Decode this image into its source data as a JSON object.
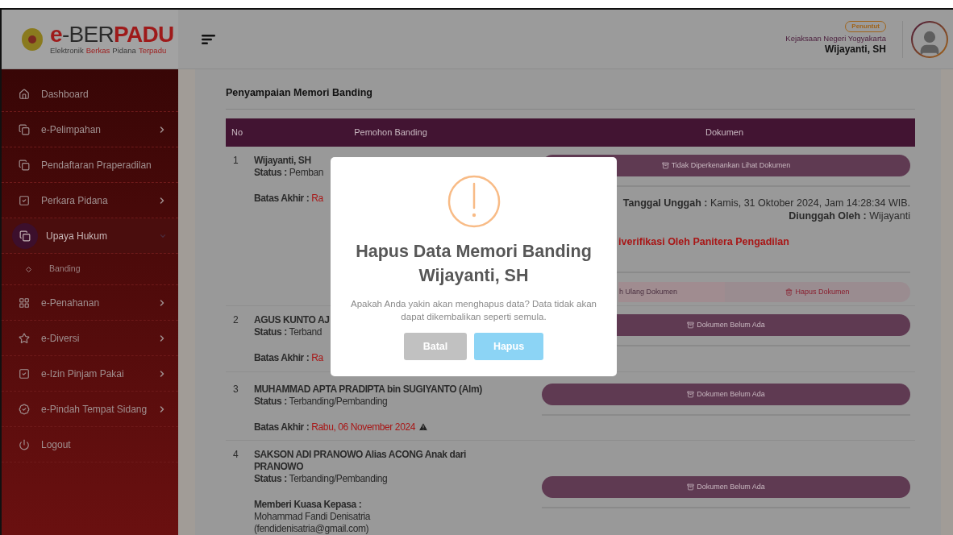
{
  "header": {
    "logo": {
      "title": [
        {
          "text": "e",
          "accent": true
        },
        {
          "text": "-BER",
          "accent": false
        },
        {
          "text": "PADU",
          "accent": true
        }
      ],
      "subtitle": [
        {
          "text": "Elektronik",
          "accent": false
        },
        {
          "text": "Berkas",
          "accent": true
        },
        {
          "text": "Pidana",
          "accent": false
        },
        {
          "text": "Terpadu",
          "accent": true
        }
      ]
    },
    "user": {
      "role": "Penuntut",
      "office": "Kejaksaan Negeri Yogyakarta",
      "name": "Wijayanti, SH"
    }
  },
  "sidebar": {
    "items": [
      {
        "label": "Dashboard",
        "submenu": false,
        "selected": false
      },
      {
        "label": "e-Pelimpahan",
        "submenu": true,
        "expanded": false,
        "selected": false
      },
      {
        "label": "Pendaftaran Praperadilan",
        "submenu": false,
        "selected": false
      },
      {
        "label": "Perkara Pidana",
        "submenu": true,
        "expanded": false,
        "selected": false
      },
      {
        "label": "Upaya Hukum",
        "submenu": true,
        "expanded": true,
        "selected": true,
        "children": [
          {
            "label": "Banding",
            "selected": false
          }
        ]
      },
      {
        "label": "e-Penahanan",
        "submenu": true,
        "expanded": false,
        "selected": false
      },
      {
        "label": "e-Diversi",
        "submenu": true,
        "expanded": false,
        "selected": false
      },
      {
        "label": "e-Izin Pinjam Pakai",
        "submenu": true,
        "expanded": false,
        "selected": false
      },
      {
        "label": "e-Pindah Tempat Sidang",
        "submenu": true,
        "expanded": false,
        "selected": false
      },
      {
        "label": "Logout",
        "submenu": false,
        "selected": false
      }
    ]
  },
  "content": {
    "title": "Penyampaian Memori Banding",
    "table": {
      "columns": [
        "No",
        "Pemohon Banding",
        "Dokumen"
      ],
      "rows": [
        {
          "no": "1",
          "name": "Wijayanti, SH",
          "status_label": "Status :",
          "status": "Pemban",
          "deadline_label": "Batas Akhir :",
          "deadline": "Ra",
          "deadline_warning": false,
          "documents": [
            {
              "kind": "button",
              "label": "Tidak Diperkenankan Lihat Dokumen"
            },
            {
              "kind": "upload_info",
              "date_label": "Tanggal Unggah :",
              "date": "Kamis, 31 Oktober 2024, Jam 14:28:34 WIB.",
              "by_label": "Diunggah Oleh :",
              "by": "Wijayanti"
            },
            {
              "kind": "verification",
              "text": "iverifikasi Oleh Panitera Pengadilan"
            },
            {
              "kind": "actions",
              "reupload": "h Ulang Dokumen",
              "delete": "Hapus Dokumen"
            }
          ]
        },
        {
          "no": "2",
          "name": "AGUS KUNTO AJ",
          "status_label": "Status :",
          "status": "Terband",
          "deadline_label": "Batas Akhir :",
          "deadline": "Ra",
          "deadline_warning": false,
          "documents": [
            {
              "kind": "button",
              "label": "Dokumen Belum Ada"
            }
          ]
        },
        {
          "no": "3",
          "name": "MUHAMMAD APTA PRADIPTA bin SUGIYANTO (Alm)",
          "status_label": "Status :",
          "status": "Terbanding/Pembanding",
          "deadline_label": "Batas Akhir :",
          "deadline": "Rabu, 06 November 2024",
          "deadline_warning": true,
          "documents": [
            {
              "kind": "button",
              "label": "Dokumen Belum Ada"
            }
          ]
        },
        {
          "no": "4",
          "name": "SAKSON ADI PRANOWO Alias ACONG Anak dari PRANOWO",
          "status_label": "Status :",
          "status": "Terbanding/Pembanding",
          "proxy_label": "Memberi Kuasa Kepasa :",
          "proxy_lines": [
            "Mohammad Fandi Denisatria",
            "(fendidenisatria@gmail.com)"
          ],
          "documents": [
            {
              "kind": "button",
              "label": "Dokumen Belum Ada"
            }
          ]
        }
      ]
    }
  },
  "modal": {
    "title": "Hapus Data Memori Banding Wijayanti, SH",
    "message": "Apakah Anda yakin akan menghapus data? Data tidak akan dapat dikembalikan seperti semula.",
    "buttons": [
      {
        "label": "Batal",
        "kind": "cancel"
      },
      {
        "label": "Hapus",
        "kind": "confirm"
      }
    ]
  }
}
